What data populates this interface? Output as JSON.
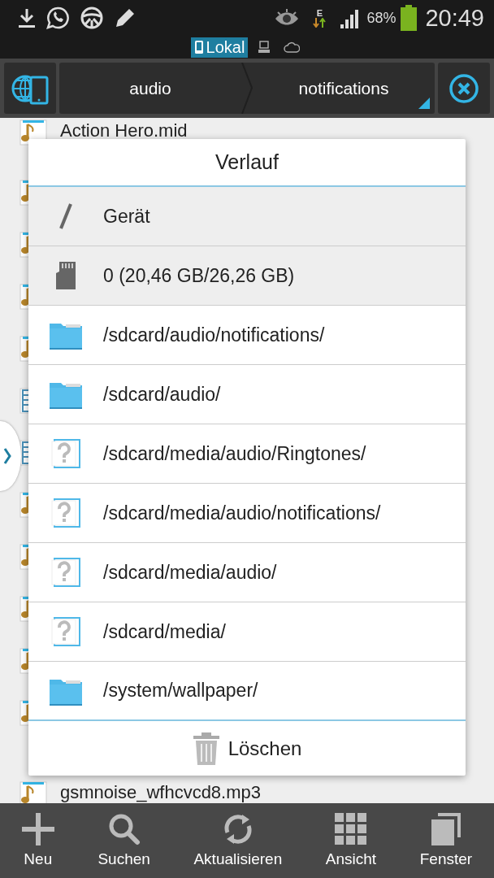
{
  "status_bar": {
    "battery": "68%",
    "time": "20:49",
    "network": "E"
  },
  "location_tabs": [
    {
      "label": "Lokal",
      "kind": "local",
      "selected": true
    },
    {
      "kind": "network",
      "selected": false
    },
    {
      "kind": "cloud",
      "selected": false
    }
  ],
  "breadcrumb": [
    "audio",
    "notifications"
  ],
  "file_list": [
    {
      "kind": "audio",
      "name": "Action Hero.mid"
    },
    {
      "kind": "audio"
    },
    {
      "kind": "audio"
    },
    {
      "kind": "audio"
    },
    {
      "kind": "audio"
    },
    {
      "kind": "video"
    },
    {
      "kind": "video"
    },
    {
      "kind": "audio"
    },
    {
      "kind": "audio"
    },
    {
      "kind": "audio"
    },
    {
      "kind": "audio"
    },
    {
      "kind": "audio"
    },
    {
      "kind": "audio",
      "name": "gsmnoise_wfhcvcd8.mp3"
    }
  ],
  "dialog": {
    "title": "Verlauf",
    "items": [
      {
        "kind": "root",
        "label": "Gerät",
        "highlighted": true
      },
      {
        "kind": "sdcard",
        "label": "0 (20,46 GB/26,26 GB)",
        "highlighted": true
      },
      {
        "kind": "folder",
        "label": "/sdcard/audio/notifications/",
        "highlighted": false
      },
      {
        "kind": "folder",
        "label": "/sdcard/audio/",
        "highlighted": false
      },
      {
        "kind": "unknown",
        "label": "/sdcard/media/audio/Ringtones/",
        "highlighted": false
      },
      {
        "kind": "unknown",
        "label": "/sdcard/media/audio/notifications/",
        "highlighted": false
      },
      {
        "kind": "unknown",
        "label": "/sdcard/media/audio/",
        "highlighted": false
      },
      {
        "kind": "unknown",
        "label": "/sdcard/media/",
        "highlighted": false
      },
      {
        "kind": "folder",
        "label": "/system/wallpaper/",
        "highlighted": false
      }
    ],
    "clear_button": "Löschen"
  },
  "bottom_bar": [
    {
      "kind": "new",
      "label": "Neu"
    },
    {
      "kind": "search",
      "label": "Suchen"
    },
    {
      "kind": "refresh",
      "label": "Aktualisieren"
    },
    {
      "kind": "view",
      "label": "Ansicht"
    },
    {
      "kind": "windows",
      "label": "Fenster"
    }
  ]
}
